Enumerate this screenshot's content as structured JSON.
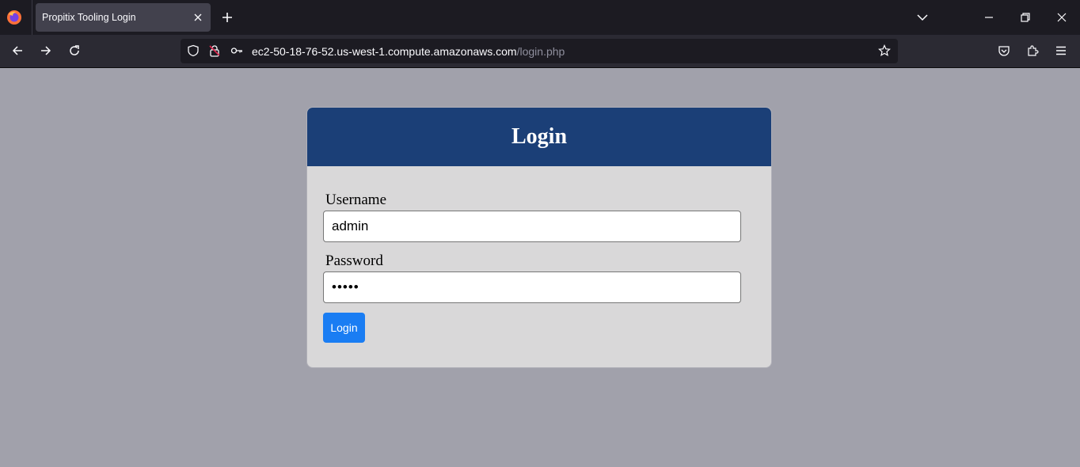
{
  "browser": {
    "tab": {
      "title": "Propitix Tooling Login",
      "close_icon": "close-icon"
    },
    "icons": {
      "logo": "firefox-logo",
      "new_tab": "plus-icon",
      "list_tabs": "chevron-down-icon",
      "minimize": "minimize-icon",
      "maximize": "restore-icon",
      "close": "close-icon",
      "back": "back-arrow-icon",
      "forward": "forward-arrow-icon",
      "reload": "reload-icon",
      "tracking": "shield-icon",
      "insecure": "insecure-lock-icon",
      "key": "key-icon",
      "bookmark": "star-icon",
      "pocket": "pocket-icon",
      "extensions": "puzzle-icon",
      "menu": "hamburger-menu-icon"
    },
    "url": {
      "host": "ec2-50-18-76-52.us-west-1.compute.amazonaws.com",
      "path": "/login.php"
    }
  },
  "login": {
    "title": "Login",
    "username_label": "Username",
    "username_value": "admin",
    "password_label": "Password",
    "password_value": "•••••",
    "submit_label": "Login"
  },
  "colors": {
    "page_bg": "#a1a1ab",
    "header_bg": "#1b3f77",
    "card_bg": "#d9d8d9",
    "button_bg": "#1a7df3"
  }
}
